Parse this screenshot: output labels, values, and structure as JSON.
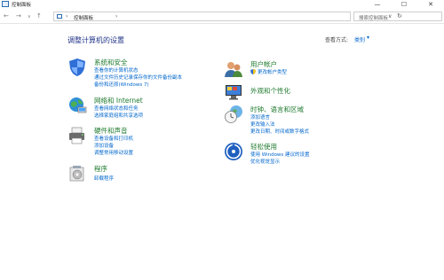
{
  "window": {
    "title": "控制面板"
  },
  "address": {
    "path": "控制面板",
    "search_placeholder": "搜索控制面板"
  },
  "window_buttons": {
    "minimize": "—",
    "maximize": "☐",
    "close": "✕"
  },
  "nav": {
    "back": "←",
    "forward": "→",
    "down": "∨",
    "up": "↑",
    "sep": "›",
    "chevron": "›",
    "dropdown": "∨",
    "refresh": "↻"
  },
  "main": {
    "heading": "调整计算机的设置",
    "view_by_label": "查看方式:",
    "view_by_value": "类别",
    "view_by_arrow": "▾"
  },
  "categories_left": [
    {
      "title": "系统和安全",
      "links": [
        "查看你的计算机状态",
        "通过文件历史记录保存你的文件备份副本",
        "备份和还原(Windows 7)"
      ]
    },
    {
      "title": "网络和 Internet",
      "links": [
        "查看网络状态和任务",
        "选择家庭组和共享选项"
      ]
    },
    {
      "title": "硬件和声音",
      "links": [
        "查看设备和打印机",
        "添加设备",
        "调整常用移动设置"
      ]
    },
    {
      "title": "程序",
      "links": [
        "卸载程序"
      ]
    }
  ],
  "categories_right": [
    {
      "title": "用户帐户",
      "links": [
        "更改帐户类型"
      ]
    },
    {
      "title": "外观和个性化",
      "links": []
    },
    {
      "title": "时钟、语言和区域",
      "links": [
        "添加语言",
        "更改输入法",
        "更改日期、时间或数字格式"
      ]
    },
    {
      "title": "轻松使用",
      "links": [
        "使用 Windows 建议的设置",
        "优化视觉显示"
      ]
    }
  ],
  "colors": {
    "title_green": "#1e7a2e",
    "link_blue": "#0066cc",
    "heading_navy": "#1e3287"
  }
}
